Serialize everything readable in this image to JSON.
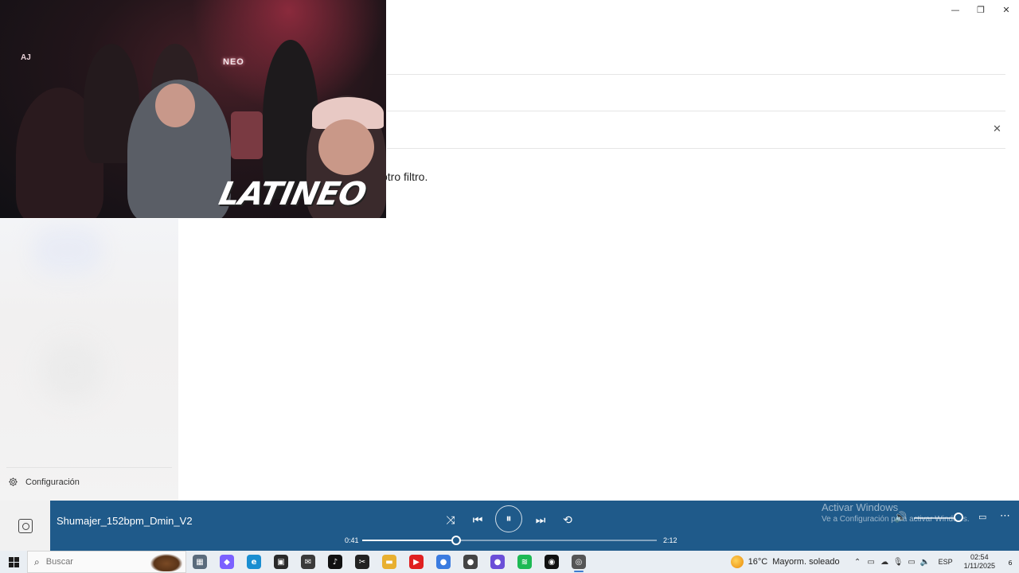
{
  "window": {
    "minimize": "—",
    "restore": "❐",
    "close": "✕"
  },
  "main": {
    "filter_message": "otro filtro.",
    "filter_close": "✕"
  },
  "sidebar": {
    "settings_label": "Configuración"
  },
  "video_overlay": {
    "neon_sign": "NEO",
    "wall_text": "AJ",
    "logo_text": "LATINEO"
  },
  "player": {
    "track_title": "Shumajer_152bpm_Dmin_V2",
    "elapsed": "0:41",
    "duration": "2:12",
    "progress_fraction": 0.32,
    "volume_fraction": 0.9,
    "shuffle_icon": "⤨",
    "prev_icon": "⏮",
    "pause_icon": "⏸",
    "next_icon": "⏭",
    "repeat_icon": "⟲",
    "volume_icon": "🔊",
    "miniplayer_icon": "▭",
    "more_icon": "⋯",
    "activate_title": "Activar Windows",
    "activate_subtitle": "Ve a Configuración para activar Windows."
  },
  "taskbar": {
    "search_placeholder": "Buscar",
    "apps": [
      {
        "name": "task-view",
        "glyph": "▦",
        "color": "#5a6b7c"
      },
      {
        "name": "copilot",
        "glyph": "◆",
        "color": "#7b61ff"
      },
      {
        "name": "edge",
        "glyph": "e",
        "color": "#1a8ed1"
      },
      {
        "name": "store",
        "glyph": "▣",
        "color": "#2a2a2a"
      },
      {
        "name": "mail",
        "glyph": "✉",
        "color": "#3a3a3a"
      },
      {
        "name": "tiktok",
        "glyph": "♪",
        "color": "#111111"
      },
      {
        "name": "capcut",
        "glyph": "✂",
        "color": "#222222"
      },
      {
        "name": "explorer",
        "glyph": "▬",
        "color": "#e8b030"
      },
      {
        "name": "youtube",
        "glyph": "▶",
        "color": "#e02020"
      },
      {
        "name": "chrome",
        "glyph": "●",
        "color": "#3a7be0"
      },
      {
        "name": "chrome-alt",
        "glyph": "●",
        "color": "#444444"
      },
      {
        "name": "chrome-profile",
        "glyph": "●",
        "color": "#6b4fd8"
      },
      {
        "name": "spotify",
        "glyph": "≋",
        "color": "#1db954"
      },
      {
        "name": "app-dark",
        "glyph": "◉",
        "color": "#111111"
      },
      {
        "name": "media-player",
        "glyph": "◎",
        "color": "#555555"
      }
    ],
    "weather_temp": "16°C",
    "weather_desc": "Mayorm. soleado",
    "language": "ESP",
    "time": "02:54",
    "date": "1/11/2025",
    "notification_count": "6"
  }
}
